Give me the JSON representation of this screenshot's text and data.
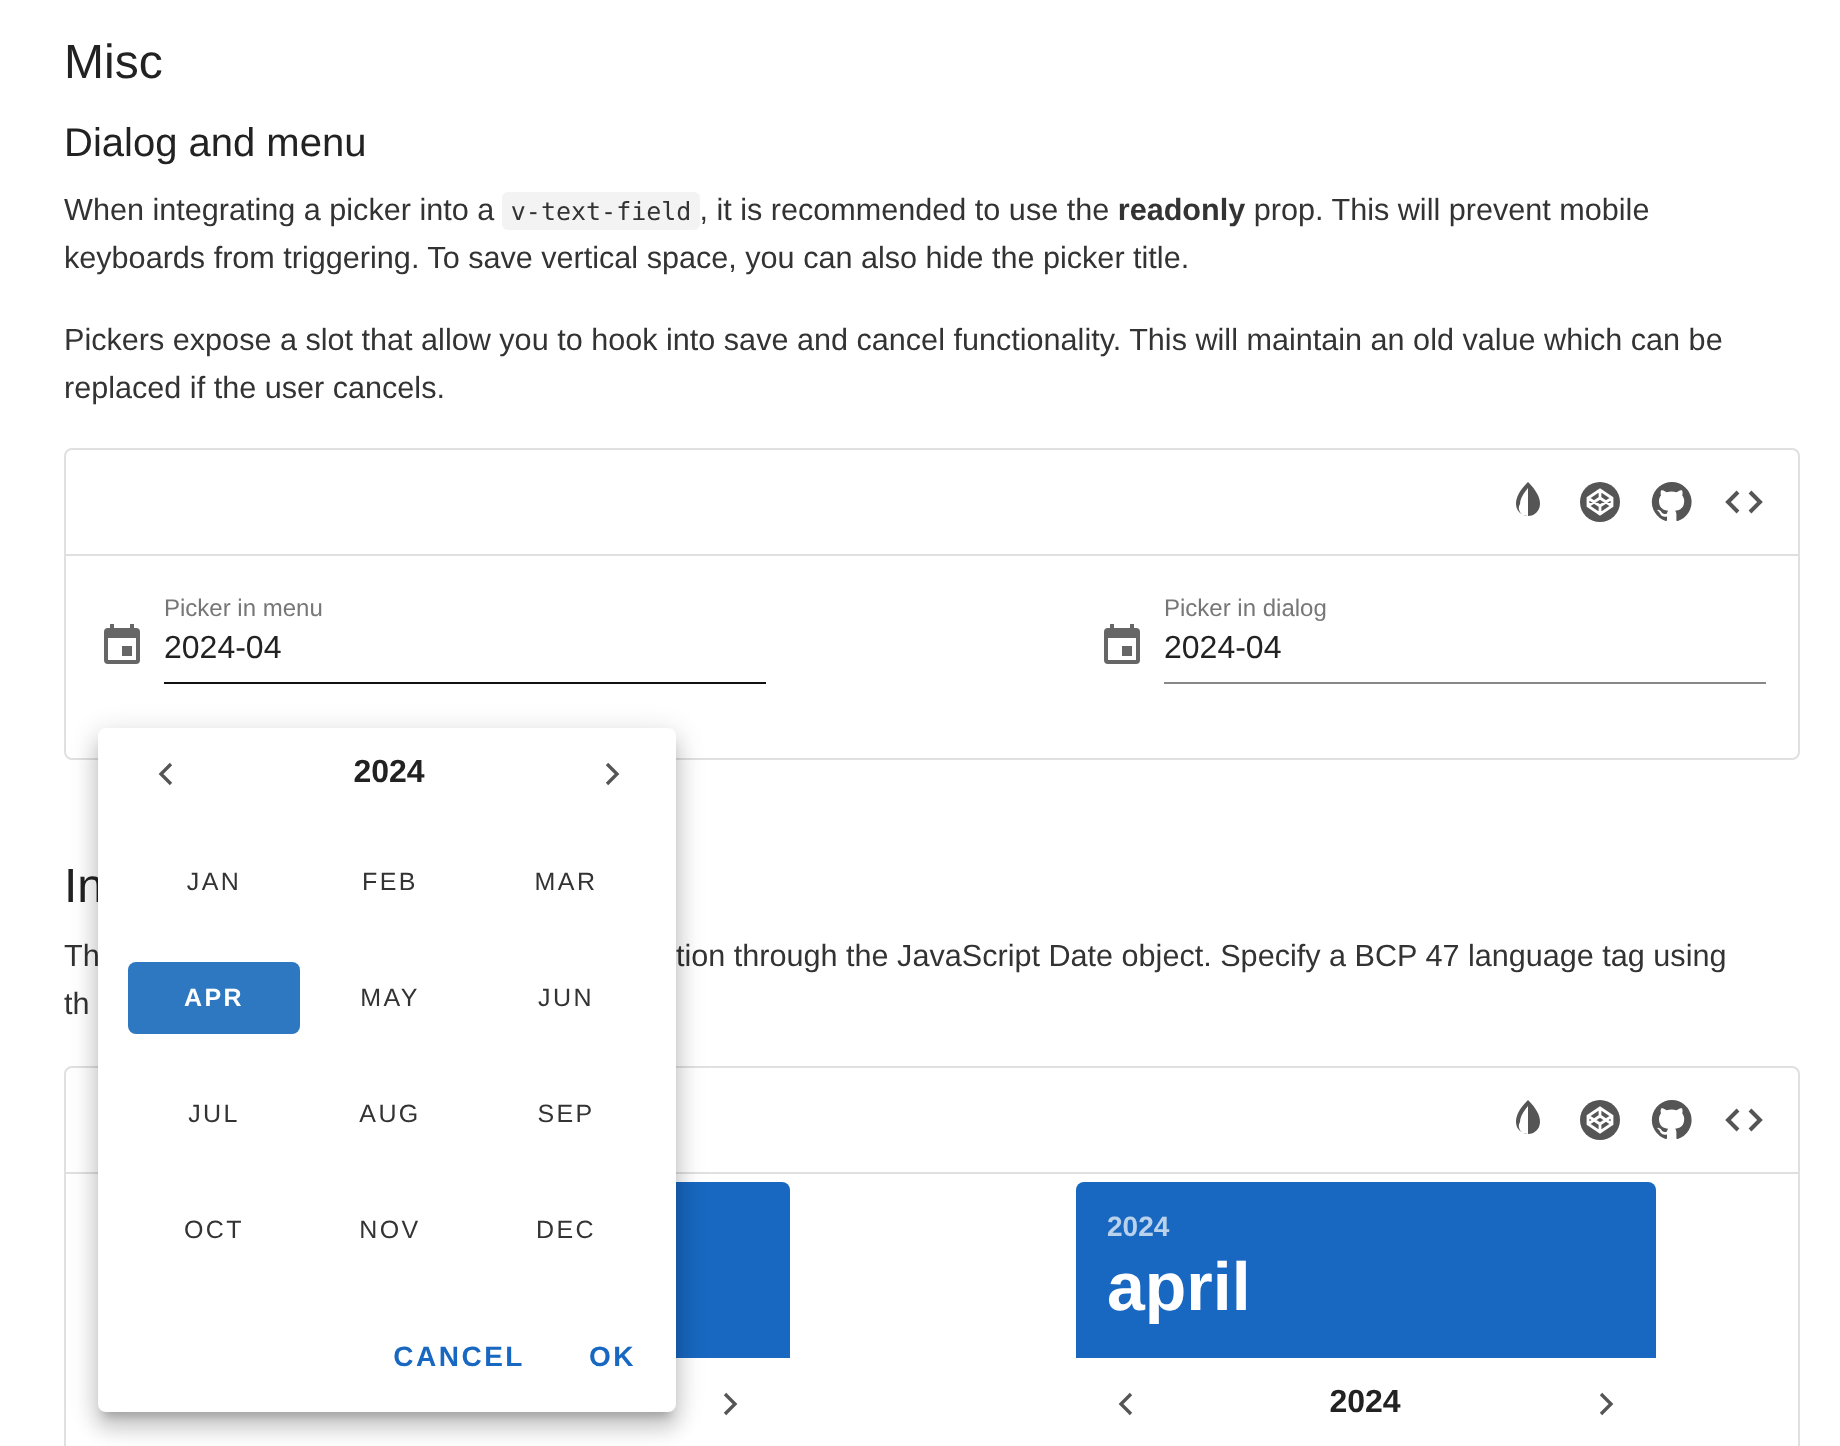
{
  "page_title": "Misc",
  "section": {
    "heading": "Dialog and menu",
    "paragraphs": [
      [
        {
          "kind": "text",
          "text": "When integrating a picker into a "
        },
        {
          "kind": "code",
          "text": "v-text-field"
        },
        {
          "kind": "text",
          "text": ", it is recommended to use the **readonly** prop. This will prevent mobile keyboards from triggering. To save vertical space, you can also hide the picker title."
        }
      ],
      [
        {
          "kind": "text",
          "text": "Pickers expose a slot that allow you to hook into save and cancel functionality. This will maintain an old value which can be replaced if the user cancels."
        }
      ]
    ],
    "fields": [
      {
        "label": "Picker in menu",
        "value": "2024-04",
        "focused": true
      },
      {
        "label": "Picker in dialog",
        "value": "2024-04",
        "focused": false
      }
    ]
  },
  "section_2": {
    "heading": "In",
    "paragraph_fragments": [
      "Th",
      "tion through the JavaScript Date object. Specify a BCP 47 language tag using",
      "th"
    ],
    "pickers": [
      {
        "kind": "covered"
      },
      {
        "kind": "full",
        "header_year": "2024",
        "month": "april",
        "year": "2024"
      }
    ]
  },
  "menu": {
    "year": "2024",
    "months": [
      {
        "label": "JAN",
        "selected": false
      },
      {
        "label": "FEB",
        "selected": false
      },
      {
        "label": "MAR",
        "selected": false
      },
      {
        "label": "APR",
        "selected": true
      },
      {
        "label": "MAY",
        "selected": false
      },
      {
        "label": "JUN",
        "selected": false
      },
      {
        "label": "JUL",
        "selected": false
      },
      {
        "label": "AUG",
        "selected": false
      },
      {
        "label": "SEP",
        "selected": false
      },
      {
        "label": "OCT",
        "selected": false
      },
      {
        "label": "NOV",
        "selected": false
      },
      {
        "label": "DEC",
        "selected": false
      }
    ],
    "actions": [
      "CANCEL",
      "OK"
    ]
  }
}
